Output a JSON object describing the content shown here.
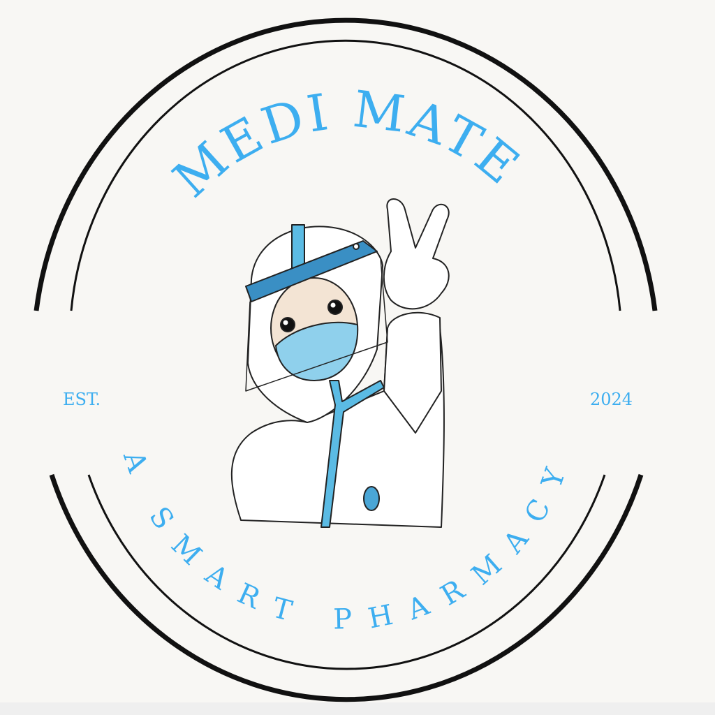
{
  "logo": {
    "title": "MEDI MATE",
    "tagline": "A SMART PHARMACY",
    "est_label": "EST.",
    "year": "2024",
    "mascot": "medic-in-ppe-peace-sign",
    "colors": {
      "text": "#3daef0",
      "ring": "#111111",
      "background": "#f8f7f4",
      "visor": "#3a8fc4",
      "mask": "#8fd0ec",
      "skin": "#f3e4d4",
      "stethoscope": "#5bbbe4"
    }
  }
}
